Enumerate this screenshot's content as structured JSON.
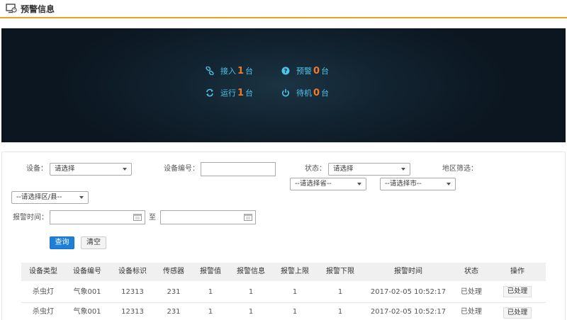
{
  "header": {
    "title": "预警信息"
  },
  "stats": {
    "connected": {
      "label": "接入",
      "value": "1",
      "unit": "台"
    },
    "warning": {
      "label": "预警",
      "value": "0",
      "unit": "台"
    },
    "running": {
      "label": "运行",
      "value": "1",
      "unit": "台"
    },
    "standby": {
      "label": "待机",
      "value": "0",
      "unit": "台"
    }
  },
  "filters": {
    "device_label": "设备：",
    "device_value": "请选择",
    "device_no_label": "设备编号：",
    "device_no_value": "",
    "status_label": "状态：",
    "status_value": "请选择",
    "region_label": "地区筛选：",
    "province_value": "--请选择省--",
    "city_value": "--请选择市--",
    "district_value": "--请选择区/县--",
    "time_label": "报警时间：",
    "time_to_label": "至",
    "time_start_value": "",
    "time_end_value": ""
  },
  "buttons": {
    "query": "查询",
    "clear": "清空"
  },
  "table": {
    "columns": [
      "设备类型",
      "设备编号",
      "设备标识",
      "传感器",
      "报警值",
      "报警信息",
      "报警上限",
      "报警下限",
      "报警时间",
      "状态",
      "操作"
    ],
    "rows": [
      [
        "杀虫灯",
        "气象001",
        "12313",
        "231",
        "1",
        "1",
        "1",
        "1",
        "2017-02-05 10:52:17",
        "已处理",
        "已处理"
      ],
      [
        "杀虫灯",
        "气象001",
        "12313",
        "231",
        "1",
        "1",
        "1",
        "1",
        "2017-02-05 10:52:17",
        "已处理",
        "已处理"
      ]
    ]
  },
  "colors": {
    "accent_line": "#e8a020",
    "stat_text": "#4fc3e8",
    "stat_number": "#f07a2a",
    "primary_button": "#1e7fd8"
  }
}
